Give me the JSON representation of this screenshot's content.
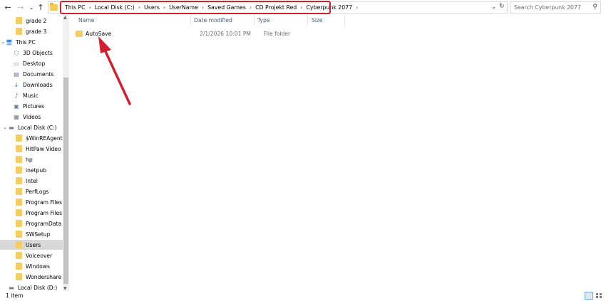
{
  "address_bar": {
    "breadcrumbs": [
      "This PC",
      "Local Disk (C:)",
      "Users",
      "UserName",
      "Saved Games",
      "CD Projekt Red",
      "Cyberpunk 2077"
    ],
    "separator": "›"
  },
  "search": {
    "placeholder": "Search Cyberpunk 2077"
  },
  "navigation": {
    "items": [
      {
        "label": "grade 2",
        "icon": "folder-icon",
        "top": 0
      },
      {
        "label": "grade 3",
        "icon": "folder-icon"
      },
      {
        "label": "This PC",
        "icon": "computer-icon"
      },
      {
        "label": "3D Objects",
        "icon": "3d-objects-icon"
      },
      {
        "label": "Desktop",
        "icon": "desktop-icon"
      },
      {
        "label": "Documents",
        "icon": "documents-icon"
      },
      {
        "label": "Downloads",
        "icon": "downloads-icon"
      },
      {
        "label": "Music",
        "icon": "music-icon"
      },
      {
        "label": "Pictures",
        "icon": "pictures-icon"
      },
      {
        "label": "Videos",
        "icon": "videos-icon"
      },
      {
        "label": "Local Disk (C:)",
        "icon": "drive-icon"
      },
      {
        "label": "$WinREAgent",
        "icon": "folder-icon"
      },
      {
        "label": "HitPaw Video C",
        "icon": "folder-icon"
      },
      {
        "label": "hp",
        "icon": "folder-icon"
      },
      {
        "label": "inetpub",
        "icon": "folder-icon"
      },
      {
        "label": "Intel",
        "icon": "folder-icon"
      },
      {
        "label": "PerfLogs",
        "icon": "folder-icon"
      },
      {
        "label": "Program Files",
        "icon": "folder-icon"
      },
      {
        "label": "Program Files (",
        "icon": "folder-icon"
      },
      {
        "label": "ProgramData",
        "icon": "folder-icon"
      },
      {
        "label": "SWSetup",
        "icon": "folder-icon"
      },
      {
        "label": "Users",
        "icon": "folder-icon",
        "selected": true
      },
      {
        "label": "Voiceover",
        "icon": "folder-icon"
      },
      {
        "label": "Windows",
        "icon": "folder-icon"
      },
      {
        "label": "Wondershare U",
        "icon": "folder-icon"
      },
      {
        "label": "Local Disk (D:)",
        "icon": "drive-icon"
      }
    ]
  },
  "columns": {
    "name": "Name",
    "date": "Date modified",
    "type": "Type",
    "size": "Size"
  },
  "files": [
    {
      "name": "AutoSave",
      "date": "2/1/2026 10:01 PM",
      "type": "File folder",
      "size": ""
    }
  ],
  "status": {
    "item_count": "1 item"
  },
  "colors": {
    "highlight": "#d3202f",
    "folder": "#f4ce63",
    "selected": "#d9d9d9"
  }
}
